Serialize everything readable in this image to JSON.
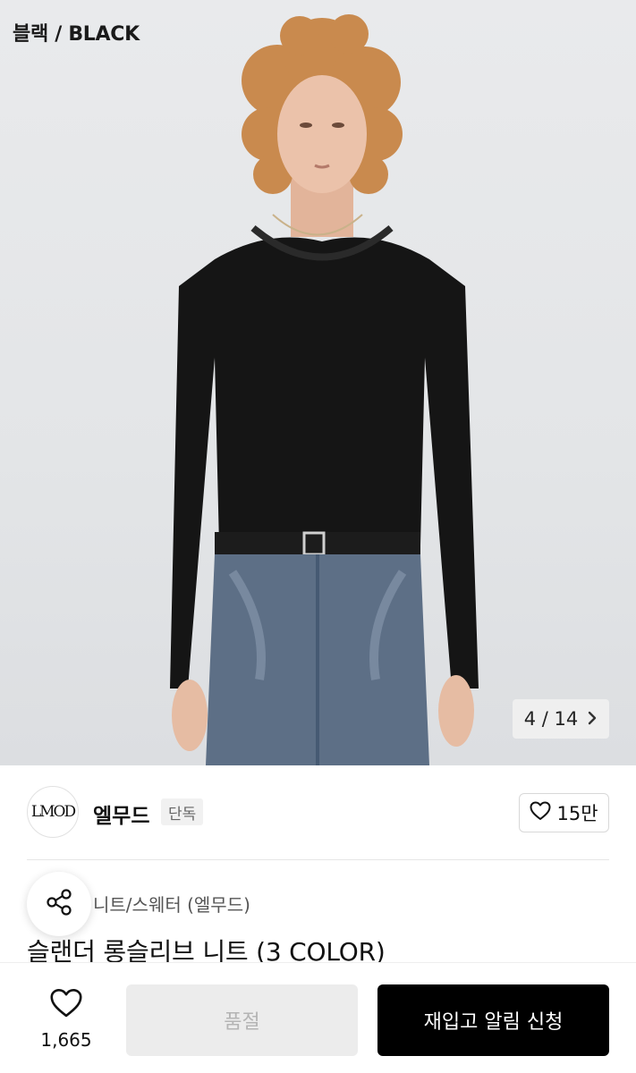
{
  "image": {
    "color_label": "블랙 / BLACK",
    "counter_current": "4",
    "counter_separator": "/",
    "counter_total": "14"
  },
  "brand": {
    "logo_text": "LMOD",
    "name": "엘무드",
    "badge": "단독",
    "like_count": "15만"
  },
  "product": {
    "category": "니트/스웨터 (엘무드)",
    "title": "슬랜더 롱슬리브 니트 (3 COLOR)"
  },
  "bottom_bar": {
    "wish_count": "1,665",
    "soldout_label": "품절",
    "restock_label": "재입고 알림 신청"
  },
  "colors": {
    "primary_button": "#000000",
    "disabled_button": "#ececec",
    "disabled_text": "#b4b4b4"
  },
  "icons": [
    "chevron-right-icon",
    "heart-icon",
    "share-icon"
  ]
}
